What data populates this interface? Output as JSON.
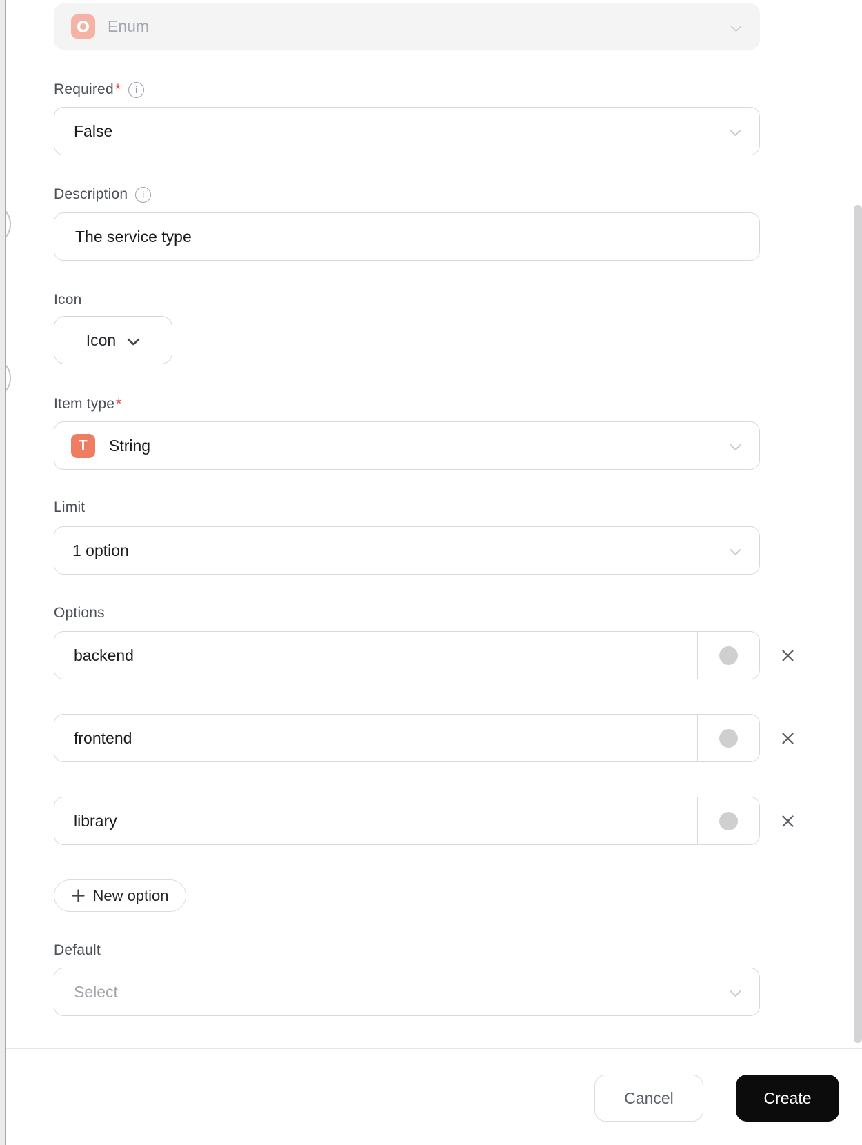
{
  "dialog": {
    "type_select": {
      "value": "Enum"
    },
    "required": {
      "label": "Required",
      "required_mark": "*",
      "info_glyph": "i",
      "value": "False"
    },
    "description": {
      "label": "Description",
      "info_glyph": "i",
      "value": "The service type"
    },
    "icon_field": {
      "label": "Icon",
      "button_label": "Icon"
    },
    "item_type": {
      "label": "Item type",
      "required_mark": "*",
      "icon_letter": "T",
      "value": "String"
    },
    "limit": {
      "label": "Limit",
      "value": "1 option"
    },
    "options": {
      "label": "Options",
      "items": [
        {
          "value": "backend"
        },
        {
          "value": "frontend"
        },
        {
          "value": "library"
        }
      ],
      "new_option_label": "New option"
    },
    "default_field": {
      "label": "Default",
      "placeholder": "Select"
    },
    "footer": {
      "cancel_label": "Cancel",
      "create_label": "Create"
    }
  },
  "colors": {
    "accent_salmon": "#ee7d62",
    "accent_salmon_disabled": "#f4b3a5",
    "required_red": "#e0443a",
    "create_button_black": "#0c0c0d",
    "swatch_gray": "#cfcfcf",
    "field_border": "#d9d9dc"
  }
}
